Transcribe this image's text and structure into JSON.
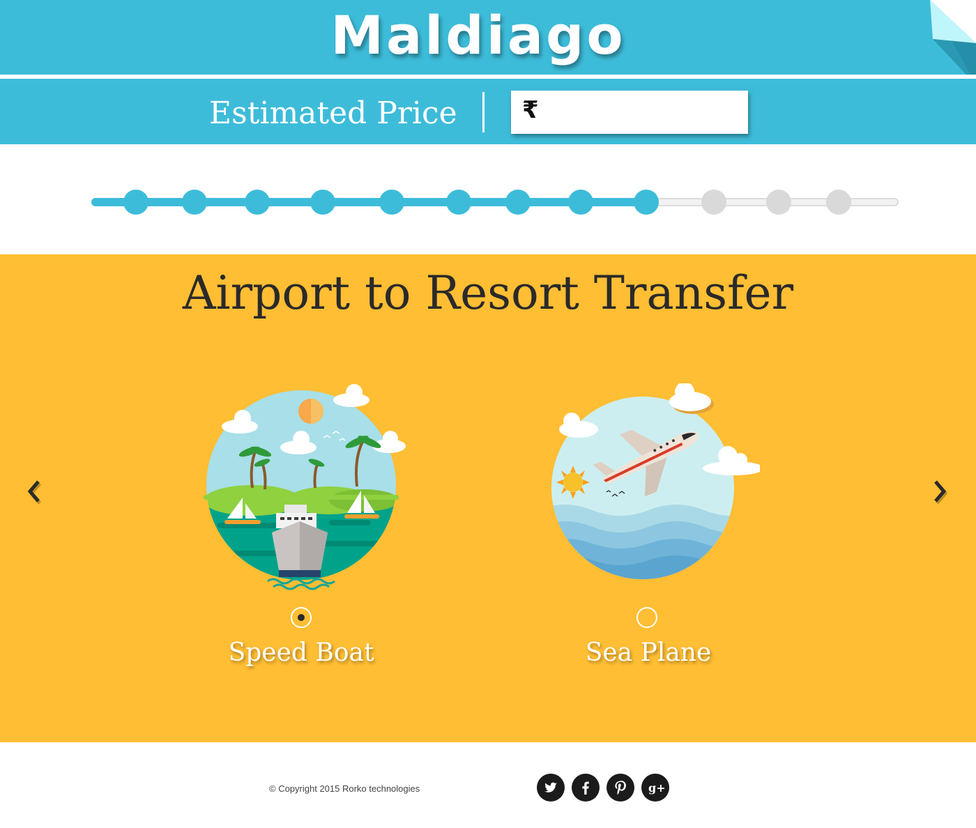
{
  "header": {
    "logo": "Maldiago",
    "price_label": "Estimated Price",
    "price_currency": "₹",
    "price_value": ""
  },
  "progress": {
    "total_steps": 12,
    "completed_steps": 9
  },
  "section": {
    "title": "Airport to Resort Transfer",
    "options": [
      {
        "label": "Speed Boat",
        "selected": true,
        "icon": "boat-island-illustration"
      },
      {
        "label": "Sea Plane",
        "selected": false,
        "icon": "seaplane-illustration"
      }
    ]
  },
  "footer": {
    "copyright": "© Copyright 2015 Rorko technologies",
    "social": [
      "twitter-icon",
      "facebook-icon",
      "pinterest-icon",
      "google-plus-icon"
    ]
  },
  "colors": {
    "brand": "#3dbcd9",
    "section_bg": "#ffbe33",
    "inactive_step": "#d9d9d9"
  }
}
